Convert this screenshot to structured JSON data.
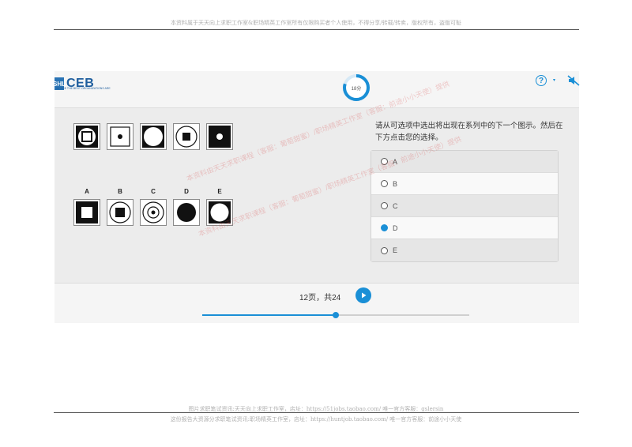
{
  "document": {
    "header_note": "本资料属于天天向上求职工作室&职场精英工作室所有仅限购买者个人使用，不得分享/转载/转卖，版权所有，盗版可耻",
    "footer_line1": "图片求职笔试资讯:天天向上求职工作室，店址：https://51jobs.taobao.com/ 唯一官方客服：gslersin",
    "footer_line2": "这份报告大资源分求职笔试资讯:职场精英工作室，店址：https://huntjob.taobao.com/ 唯一官方客服：前途小小天使"
  },
  "app": {
    "logo_text": "CEB",
    "logo_mark": "SHL",
    "logo_tagline": "WHERE THE BEST ORGANIZATIONS ARE",
    "timer_label": "18分",
    "timer_progress": 0.8,
    "help_symbol": "?",
    "help_caret": "▾",
    "accent": "#1a8fd6"
  },
  "question": {
    "prompt": "请从可选项中选出将出现在系列中的下一个图示。然后在下方点击您的选择。",
    "series": [
      {
        "outer": "black",
        "inner": "circle-square"
      },
      {
        "outer": "white-square",
        "inner": "dot"
      },
      {
        "outer": "black",
        "inner": "big-circle"
      },
      {
        "outer": "white-circle",
        "inner": "square"
      },
      {
        "outer": "black",
        "inner": "dot-white"
      }
    ],
    "options": [
      {
        "label": "A",
        "outer": "black",
        "inner": "white-square"
      },
      {
        "label": "B",
        "outer": "white-circle",
        "inner": "black-square"
      },
      {
        "label": "C",
        "outer": "white-circle",
        "inner": "ring-dot"
      },
      {
        "label": "D",
        "outer": "white",
        "inner": "black-circle"
      },
      {
        "label": "E",
        "outer": "black",
        "inner": "white-circle"
      }
    ],
    "choices": [
      {
        "label": "A",
        "checked": false
      },
      {
        "label": "B",
        "checked": false
      },
      {
        "label": "C",
        "checked": false
      },
      {
        "label": "D",
        "checked": true
      },
      {
        "label": "E",
        "checked": false
      }
    ]
  },
  "navigation": {
    "page_text": "12页，共24",
    "progress": 0.5
  },
  "watermark": {
    "text": "本资料由天天求职课程（客服：葡萄甜蜜）/职场精英工作室（客服：前途小小天使）提供"
  }
}
